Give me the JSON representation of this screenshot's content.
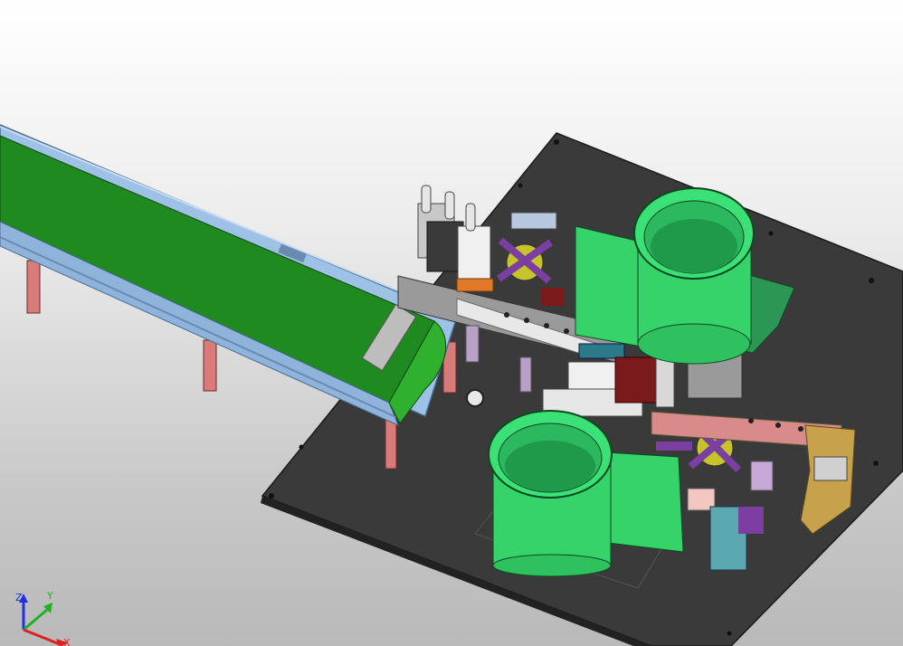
{
  "viewport": {
    "background_top": "#ffffff",
    "background_bottom": "#bcbcbc"
  },
  "model": {
    "colors": {
      "base_plate": "#3a3a3a",
      "conveyor_belt": "#1f8a1f",
      "conveyor_rail": "#8fb4dc",
      "feeder_bowl": "#35d36a",
      "leg": "#d97b7b",
      "purple_parts": "#7a3fa0",
      "yellow_support": "#c8a24a"
    }
  },
  "triad": {
    "z_label": "Z",
    "y_label": "Y",
    "x_label": "X",
    "colors": {
      "x": "#e02020",
      "y": "#20b020",
      "z": "#2030e0"
    }
  }
}
